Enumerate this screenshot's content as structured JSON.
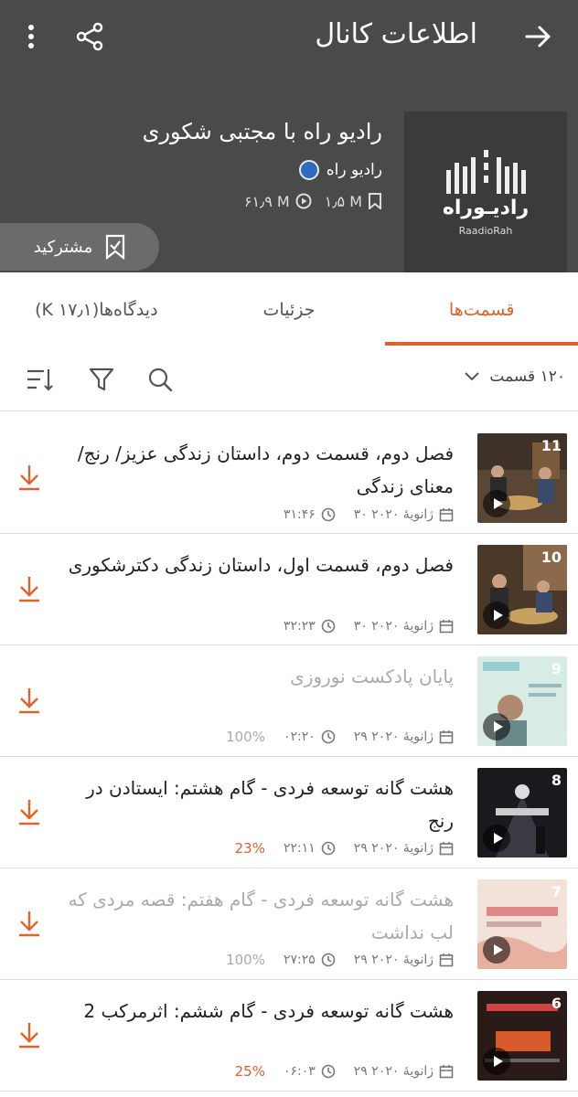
{
  "header": {
    "title": "اطلاعات کانال",
    "back_icon": "arrow-right-icon",
    "share_icon": "share-icon",
    "more_icon": "more-vertical-icon"
  },
  "channel": {
    "name": "رادیو راه با مجتبی شکوری",
    "publisher": "رادیو راه",
    "subscribers": "۱٫۵ M",
    "plays": "۶۱٫۹ M",
    "logo_text": "رادیـوراه",
    "logo_sub": "RaadioRah",
    "subscribe_label": "مشترکید"
  },
  "tabs": [
    {
      "label": "قسمت‌ها",
      "active": true
    },
    {
      "label": "جزئیات",
      "active": false
    },
    {
      "label": "دیدگاه‌ها(۱۷٫۱ K)",
      "active": false
    }
  ],
  "toolbar": {
    "episode_count": "۱۲۰ قسمت"
  },
  "episodes": [
    {
      "number": "11",
      "title": "فصل دوم، قسمت دوم، داستان زندگی عزیز/ رنج/ معنای زندگی",
      "date": "۳۰ ژانویهٔ ۲۰۲۰",
      "duration": "۳۱:۴۶",
      "progress": ""
    },
    {
      "number": "10",
      "title": "فصل دوم، قسمت اول، داستان زندگی دکترشکوری",
      "date": "۳۰ ژانویهٔ ۲۰۲۰",
      "duration": "۳۲:۲۳",
      "progress": ""
    },
    {
      "number": "9",
      "title": "پایان پادکست نوروزی",
      "date": "۲۹ ژانویهٔ ۲۰۲۰",
      "duration": "۰۲:۲۰",
      "progress": "100%"
    },
    {
      "number": "8",
      "title": "هشت گانه توسعه فردی - گام هشتم: ایستادن در رنج",
      "date": "۲۹ ژانویهٔ ۲۰۲۰",
      "duration": "۲۲:۱۱",
      "progress": "23%"
    },
    {
      "number": "7",
      "title": "هشت گانه توسعه فردی - گام هفتم: قصه مردی که لب نداشت",
      "date": "۲۹ ژانویهٔ ۲۰۲۰",
      "duration": "۲۷:۲۵",
      "progress": "100%"
    },
    {
      "number": "6",
      "title": "هشت گانه توسعه فردی - گام ششم: اثرمرکب 2",
      "date": "۲۹ ژانویهٔ ۲۰۲۰",
      "duration": "۰۶:۰۳",
      "progress": "25%"
    }
  ],
  "colors": {
    "accent": "#e0612b",
    "header": "#4a4a4a"
  }
}
